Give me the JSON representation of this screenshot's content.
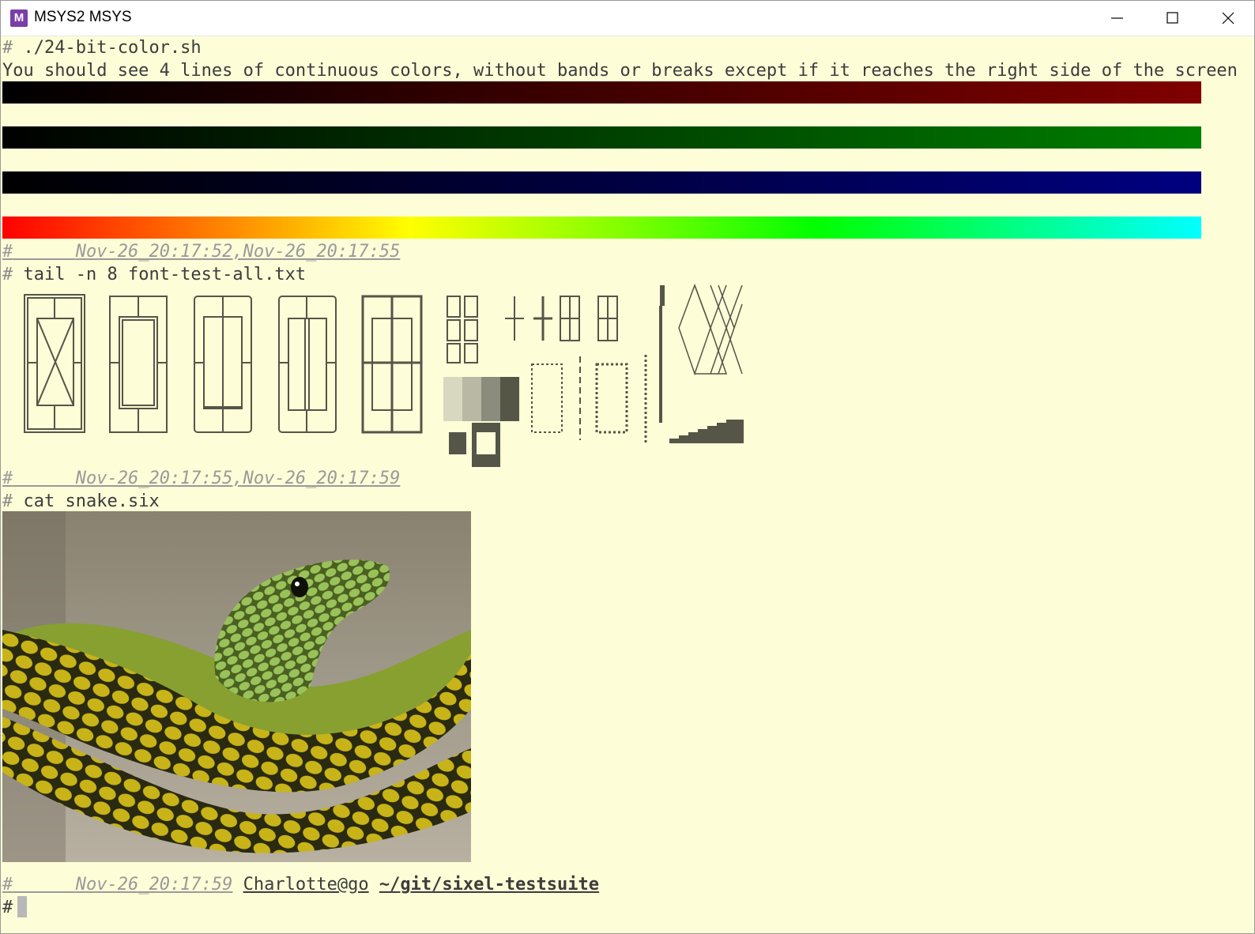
{
  "window": {
    "title": "MSYS2 MSYS",
    "icon": "msys2-app-icon",
    "icon_letter": "M",
    "controls": [
      "minimize-icon",
      "maximize-icon",
      "close-icon"
    ]
  },
  "terminal": {
    "background": "#fdfdd8",
    "foreground": "#3c3c3c",
    "prompt_char": "#",
    "cmd1": "./24-bit-color.sh",
    "msg1": "You should see 4 lines of continuous colors, without bands or breaks except if it reaches the right side of the screen",
    "color_bars": [
      {
        "name": "red",
        "from": "#000000",
        "to": "#800000"
      },
      {
        "name": "green",
        "from": "#000000",
        "to": "#008000"
      },
      {
        "name": "blue",
        "from": "#000000",
        "to": "#000080"
      },
      {
        "name": "rainbow",
        "from": "#ff0000",
        "to": "#00ffff"
      }
    ],
    "ts1": "Nov-26_20:17:52,Nov-26_20:17:55",
    "cmd2": "tail -n 8 font-test-all.txt",
    "ts2": "Nov-26_20:17:55,Nov-26_20:17:59",
    "cmd3": "cat snake.six",
    "ts3": "Nov-26_20:17:59",
    "user": "Charlotte@go",
    "path": "~/git/sixel-testsuite"
  }
}
